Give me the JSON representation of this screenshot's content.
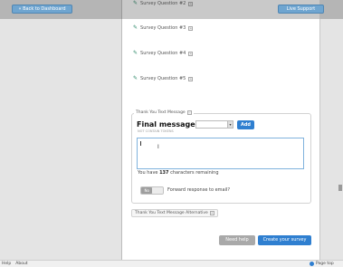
{
  "header": {
    "back_label": "« Back to Dashboard",
    "support_label": "Live Support"
  },
  "survey_questions": [
    {
      "label": "Survey Question #2",
      "toggle": "+"
    },
    {
      "label": "Survey Question #3",
      "toggle": "+"
    },
    {
      "label": "Survey Question #4",
      "toggle": "+"
    },
    {
      "label": "Survey Question #5",
      "toggle": "+"
    }
  ],
  "thank_you": {
    "tab_label": "Thank You Text Message",
    "tab_toggle": "–",
    "title": "Final message",
    "subtitle": "NOT CONTAIN TOKENS",
    "select_value": "",
    "add_label": "Add",
    "textarea_value": "",
    "remaining_prefix": "You have",
    "remaining_count": "137",
    "remaining_suffix": "characters remaining",
    "toggle_off_label": "No",
    "forward_label": "Forward response to email?"
  },
  "alternative": {
    "tab_label": "Thank You Text Message Alternative",
    "tab_toggle": "+"
  },
  "actions": {
    "need_help_label": "Need help",
    "create_label": "Create your survey"
  },
  "footer": {
    "help_label": "Help",
    "about_label": "About",
    "page_top_label": "Page top"
  }
}
